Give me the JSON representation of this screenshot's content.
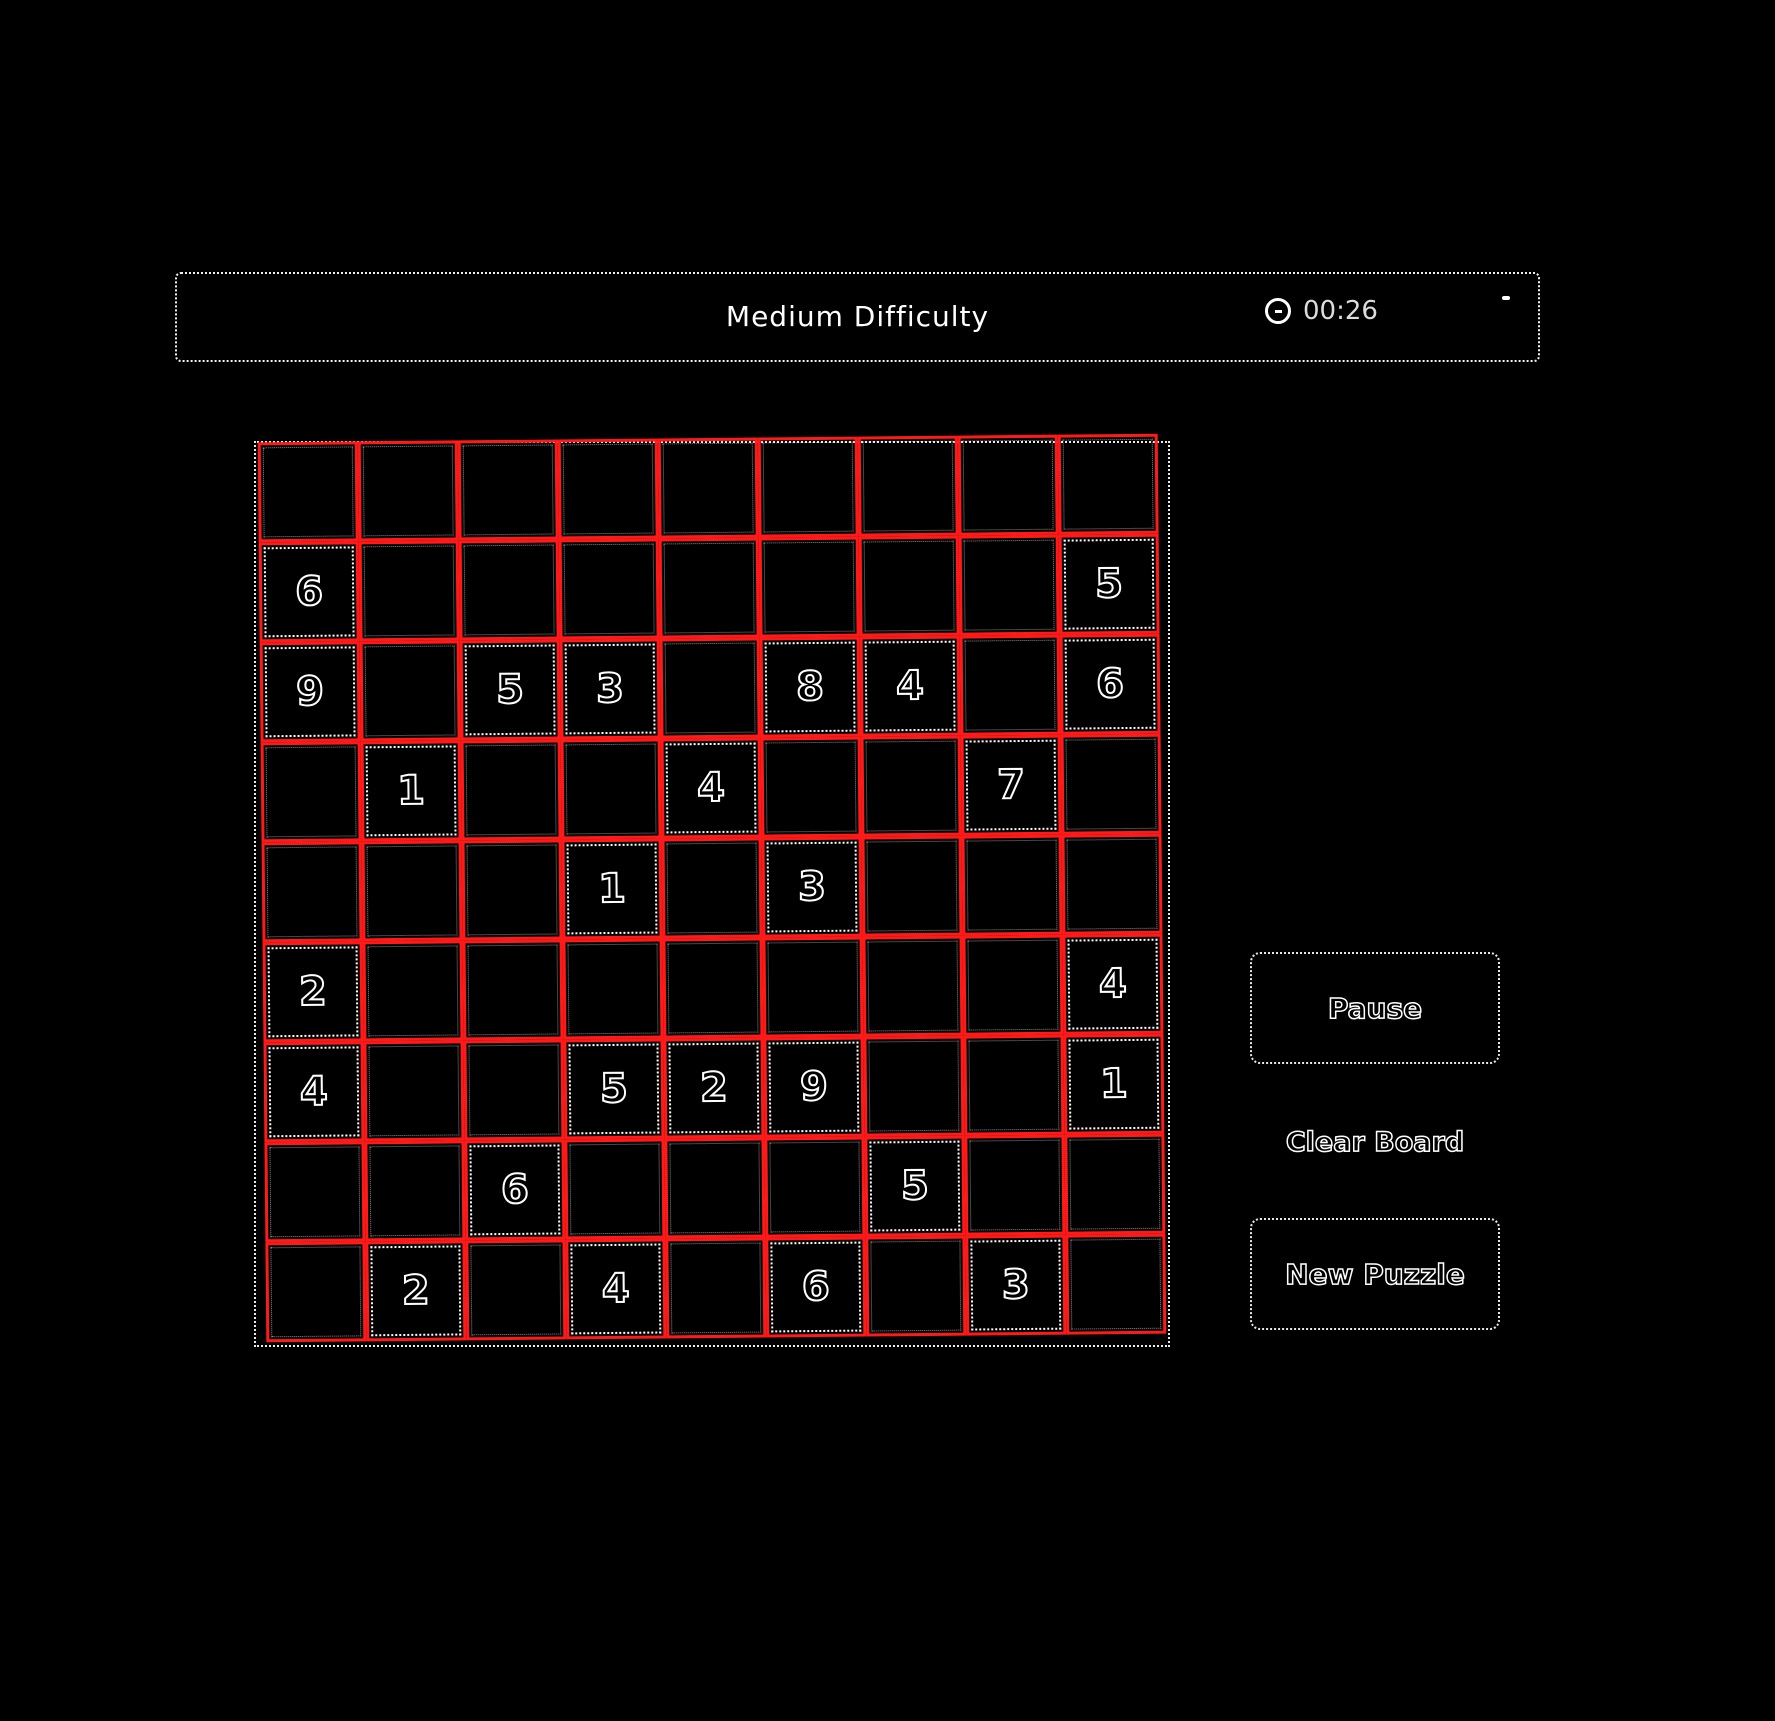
{
  "header": {
    "title": "Medium Difficulty",
    "timer": "00:26",
    "timer_icon": "clock-icon"
  },
  "board": {
    "rows": [
      [
        "",
        "",
        "",
        "",
        "",
        "",
        "",
        "",
        ""
      ],
      [
        "6",
        "",
        "",
        "",
        "",
        "",
        "",
        "",
        "5"
      ],
      [
        "9",
        "",
        "5",
        "3",
        "",
        "8",
        "4",
        "",
        "6"
      ],
      [
        "",
        "1",
        "",
        "",
        "4",
        "",
        "",
        "7",
        ""
      ],
      [
        "",
        "",
        "",
        "1",
        "",
        "3",
        "",
        "",
        ""
      ],
      [
        "2",
        "",
        "",
        "",
        "",
        "",
        "",
        "",
        "4"
      ],
      [
        "4",
        "",
        "",
        "5",
        "2",
        "9",
        "",
        "",
        "1"
      ],
      [
        "",
        "",
        "6",
        "",
        "",
        "",
        "5",
        "",
        ""
      ],
      [
        "",
        "2",
        "",
        "4",
        "",
        "6",
        "",
        "3",
        ""
      ]
    ]
  },
  "controls": {
    "pause_label": "Pause",
    "clear_label": "Clear Board",
    "new_label": "New Puzzle"
  },
  "colors": {
    "background": "#000000",
    "grid_line": "#ff1a1a",
    "outline": "#ffffff"
  }
}
